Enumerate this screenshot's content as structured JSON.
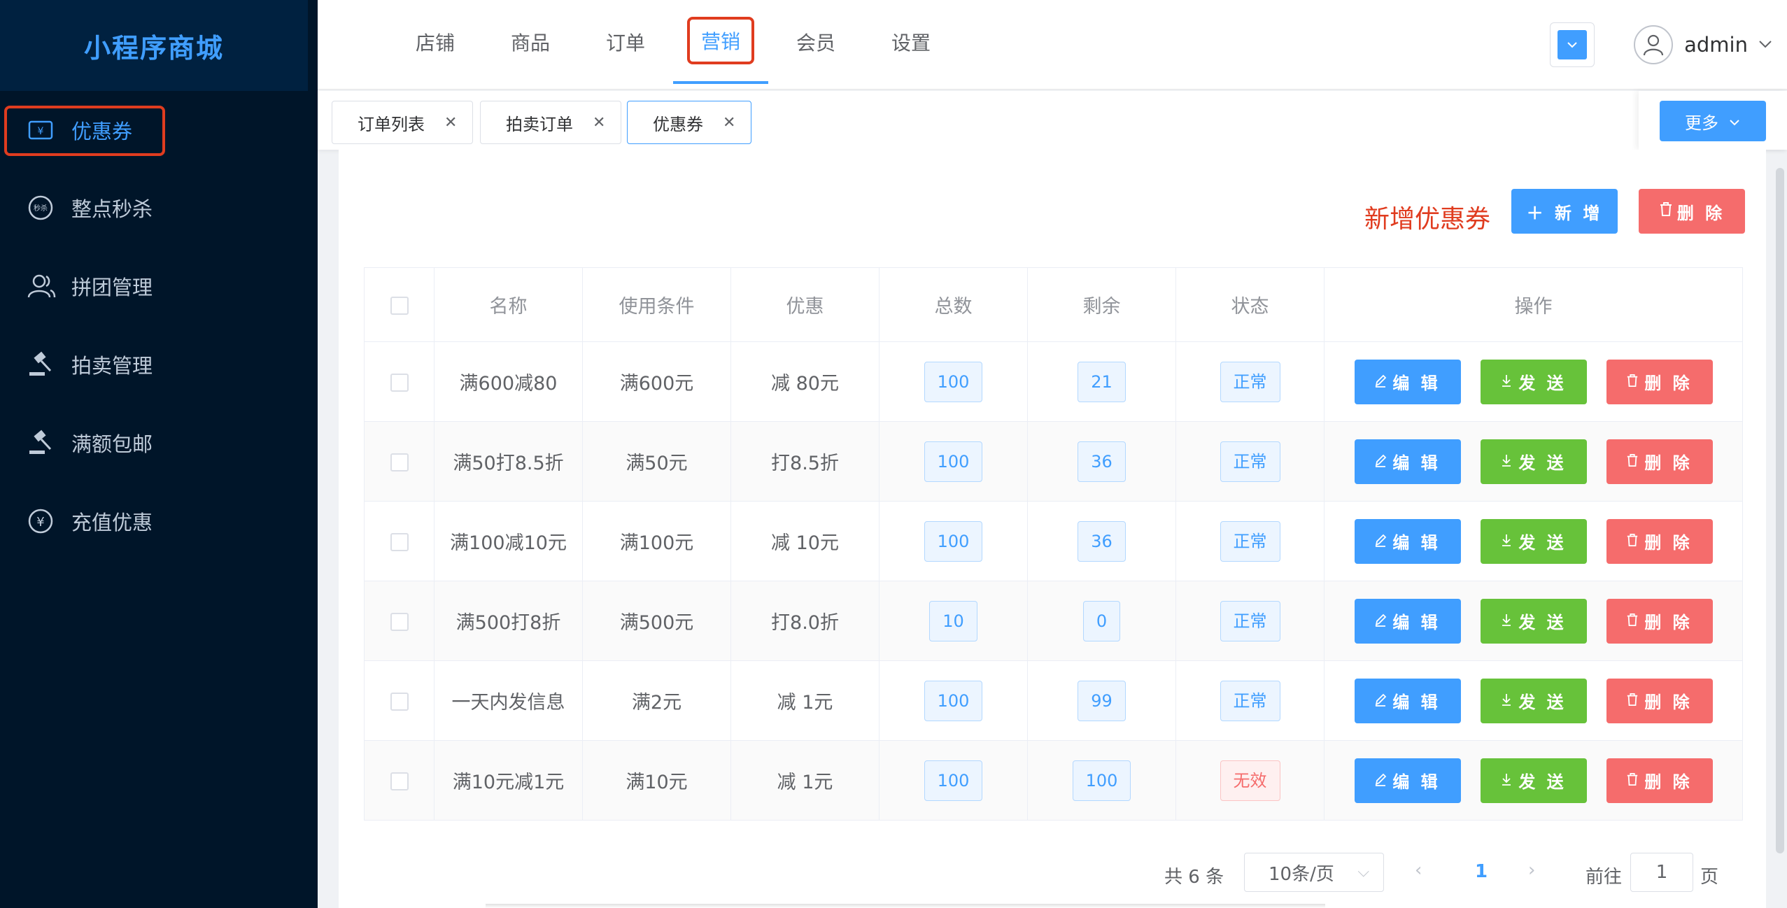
{
  "app": {
    "title": "小程序商城"
  },
  "sidebar": {
    "items": [
      {
        "label": "优惠券",
        "icon": "coupon-icon"
      },
      {
        "label": "整点秒杀",
        "icon": "flash-sale-icon"
      },
      {
        "label": "拼团管理",
        "icon": "group-icon"
      },
      {
        "label": "拍卖管理",
        "icon": "auction-icon"
      },
      {
        "label": "满额包邮",
        "icon": "auction-icon"
      },
      {
        "label": "充值优惠",
        "icon": "yen-icon"
      }
    ]
  },
  "topnav": {
    "items": [
      "店铺",
      "商品",
      "订单",
      "营销",
      "会员",
      "设置"
    ],
    "active": "营销"
  },
  "user": {
    "name": "admin"
  },
  "tabs": [
    {
      "label": "订单列表"
    },
    {
      "label": "拍卖订单"
    },
    {
      "label": "优惠券"
    }
  ],
  "more_label": "更多",
  "toolbar": {
    "title": "新增优惠券",
    "add_label": "＋ 新 增",
    "delete_label": "删 除"
  },
  "table": {
    "headers": [
      "名称",
      "使用条件",
      "优惠",
      "总数",
      "剩余",
      "状态",
      "操作"
    ],
    "rows": [
      {
        "name": "满600减80",
        "condition": "满600元",
        "discount": "减 80元",
        "total": "100",
        "remain": "21",
        "status": "正常"
      },
      {
        "name": "满50打8.5折",
        "condition": "满50元",
        "discount": "打8.5折",
        "total": "100",
        "remain": "36",
        "status": "正常"
      },
      {
        "name": "满100减10元",
        "condition": "满100元",
        "discount": "减 10元",
        "total": "100",
        "remain": "36",
        "status": "正常"
      },
      {
        "name": "满500打8折",
        "condition": "满500元",
        "discount": "打8.0折",
        "total": "10",
        "remain": "0",
        "status": "正常"
      },
      {
        "name": "一天内发信息",
        "condition": "满2元",
        "discount": "减 1元",
        "total": "100",
        "remain": "99",
        "status": "正常"
      },
      {
        "name": "满10元减1元",
        "condition": "满10元",
        "discount": "减 1元",
        "total": "100",
        "remain": "100",
        "status": "无效"
      }
    ],
    "ops": {
      "edit": "编 辑",
      "send": "发 送",
      "delete": "删 除"
    }
  },
  "pager": {
    "total": "共 6 条",
    "size": "10条/页",
    "current": "1",
    "goto": "前往",
    "jump_value": "1",
    "page_suffix": "页"
  },
  "colors": {
    "accent": "#409eff",
    "success": "#67c23a",
    "danger": "#f56c6c",
    "highlight": "#e03c1f",
    "sidebar_bg": "#001529"
  }
}
